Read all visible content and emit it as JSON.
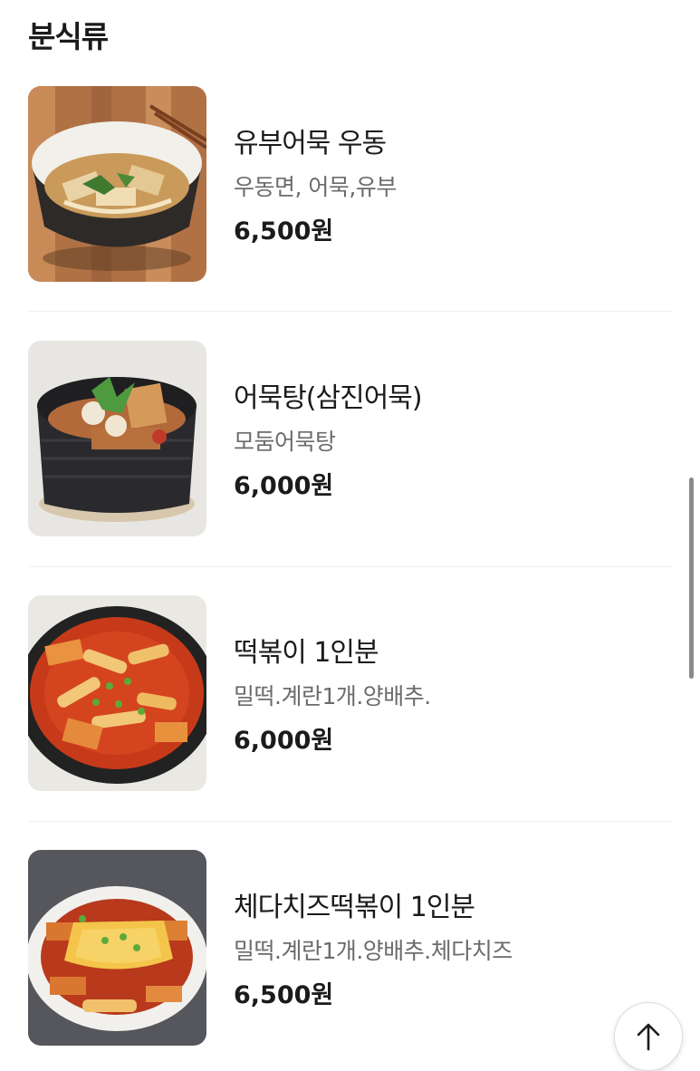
{
  "section": {
    "title": "분식류"
  },
  "items": [
    {
      "name": "유부어묵 우동",
      "description": "우동면, 어묵,유부",
      "price": "6,500원",
      "image": "udon-bowl-image"
    },
    {
      "name": "어묵탕(삼진어묵)",
      "description": "모둠어묵탕",
      "price": "6,000원",
      "image": "fishcake-soup-image"
    },
    {
      "name": "떡볶이 1인분",
      "description": "밀떡.계란1개.양배추.",
      "price": "6,000원",
      "image": "tteokbokki-image"
    },
    {
      "name": "체다치즈떡볶이 1인분",
      "description": "밀떡.계란1개.양배추.체다치즈",
      "price": "6,500원",
      "image": "cheese-tteokbokki-image"
    }
  ],
  "controls": {
    "scroll_top_icon": "arrow-up-icon"
  },
  "colors": {
    "price": "#1b1b1b",
    "description": "#6b6b6b",
    "divider": "#efefef"
  }
}
